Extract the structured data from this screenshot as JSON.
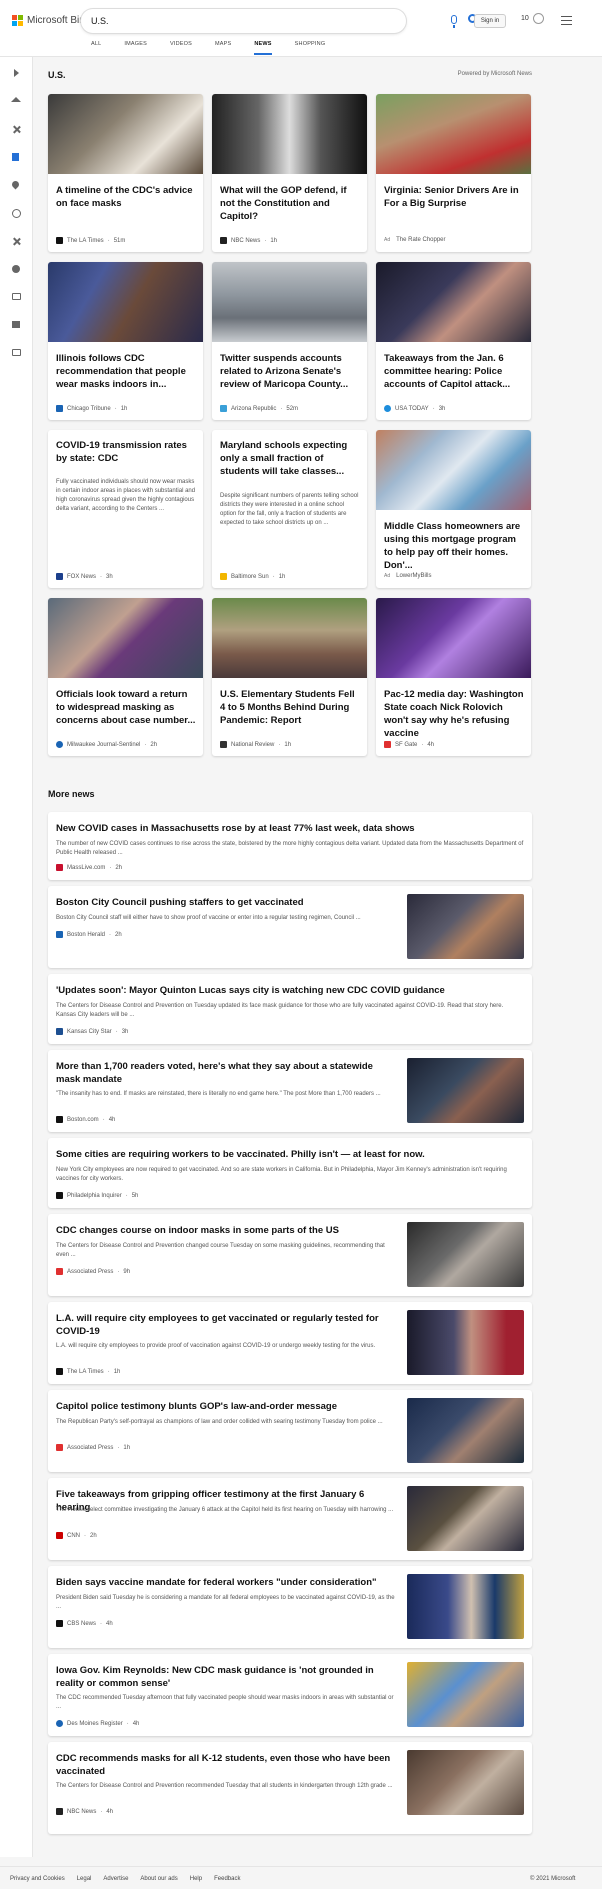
{
  "brand": {
    "name": "Microsoft Bing"
  },
  "search": {
    "query": "U.S."
  },
  "header": {
    "sign_in": "Sign in",
    "rewards_points": "10"
  },
  "tabs": [
    "ALL",
    "IMAGES",
    "VIDEOS",
    "MAPS",
    "NEWS",
    "SHOPPING"
  ],
  "section": {
    "title": "U.S.",
    "powered_by": "Powered by Microsoft News"
  },
  "cards": [
    {
      "title": "A timeline of the CDC's advice on face masks",
      "source": "The LA Times",
      "time": "51m",
      "ad": false,
      "fav": "#111"
    },
    {
      "title": "What will the GOP defend, if not the Constitution and Capitol?",
      "source": "NBC News",
      "time": "1h",
      "ad": false,
      "fav": "#222"
    },
    {
      "title": "Virginia: Senior Drivers Are in For a Big Surprise",
      "source": "The Rate Chopper",
      "time": "",
      "ad": true,
      "ad_label": "Ad",
      "fav": "#fff"
    },
    {
      "title": "Illinois follows CDC recommendation that people wear masks indoors in...",
      "source": "Chicago Tribune",
      "time": "1h",
      "ad": false,
      "fav": "#1a64b4"
    },
    {
      "title": "Twitter suspends accounts related to Arizona Senate's review of Maricopa County...",
      "source": "Arizona Republic",
      "time": "52m",
      "ad": false,
      "fav": "#3aa0d8"
    },
    {
      "title": "Takeaways from the Jan. 6 committee hearing: Police accounts of Capitol attack...",
      "source": "USA TODAY",
      "time": "3h",
      "ad": false,
      "fav": "#1d8ddc"
    },
    {
      "title": "COVID-19 transmission rates by state: CDC",
      "snippet": "Fully vaccinated individuals should now wear masks in certain indoor areas in places with substantial and high coronavirus spread given the highly contagious delta variant, according to the Centers ...",
      "source": "FOX News",
      "time": "3h",
      "ad": false,
      "fav": "#1c3f8c"
    },
    {
      "title": "Maryland schools expecting only a small fraction of students will take classes...",
      "snippet": "Despite significant numbers of parents telling school districts they were interested in a online school option for the fall, only a fraction of students are expected to take school districts up on ...",
      "source": "Baltimore Sun",
      "time": "1h",
      "ad": false,
      "fav": "#f2b600"
    },
    {
      "title": "Middle Class homeowners are using this mortgage program to help pay off their homes. Don'...",
      "source": "LowerMyBills",
      "time": "",
      "ad": true,
      "ad_label": "Ad",
      "fav": "#fff"
    },
    {
      "title": "Officials look toward a return to widespread masking as concerns about case number...",
      "source": "Milwaukee Journal-Sentinel",
      "time": "2h",
      "ad": false,
      "fav": "#1a64b4"
    },
    {
      "title": "U.S. Elementary Students Fell 4 to 5 Months Behind During Pandemic: Report",
      "source": "National Review",
      "time": "1h",
      "ad": false,
      "fav": "#333"
    },
    {
      "title": "Pac-12 media day: Washington State coach Nick Rolovich won't say why he's refusing vaccine",
      "source": "SF Gate",
      "time": "4h",
      "ad": false,
      "fav": "#e03030"
    }
  ],
  "more_news": {
    "title": "More news",
    "items": [
      {
        "title": "New COVID cases in Massachusetts rose by at least 77% last week, data shows",
        "snippet": "The number of new COVID cases continues to rise across the state, bolstered by the more highly contagious delta variant. Updated data from the Massachusetts Department of Public Health released ...",
        "source": "MassLive.com",
        "time": "2h",
        "fav": "#c8102e"
      },
      {
        "title": "Boston City Council pushing staffers to get vaccinated",
        "snippet": "Boston City Council staff will either have to show proof of vaccine or enter into a regular testing regimen, Council ...",
        "source": "Boston Herald",
        "time": "2h",
        "fav": "#1a64b4"
      },
      {
        "title": "'Updates soon': Mayor Quinton Lucas says city is watching new CDC COVID guidance",
        "snippet": "The Centers for Disease Control and Prevention on Tuesday updated its face mask guidance for those who are fully vaccinated against COVID-19. Read that story here. Kansas City leaders will be ...",
        "source": "Kansas City Star",
        "time": "3h",
        "fav": "#1d4f91"
      },
      {
        "title": "More than 1,700 readers voted, here's what they say about a statewide mask mandate",
        "snippet": "\"The insanity has to end. If masks are reinstated, there is literally no end game here.\" The post More than 1,700 readers ...",
        "source": "Boston.com",
        "time": "4h",
        "fav": "#111"
      },
      {
        "title": "Some cities are requiring workers to be vaccinated. Philly isn't — at least for now.",
        "snippet": "New York City employees are now required to get vaccinated. And so are state workers in California. But in Philadelphia, Mayor Jim Kenney's administration isn't requiring vaccines for city workers.",
        "source": "Philadelphia Inquirer",
        "time": "5h",
        "fav": "#111"
      },
      {
        "title": "CDC changes course on indoor masks in some parts of the US",
        "snippet": "The Centers for Disease Control and Prevention changed course Tuesday on some masking guidelines, recommending that even ...",
        "source": "Associated Press",
        "time": "9h",
        "fav": "#e03030"
      },
      {
        "title": "L.A. will require city employees to get vaccinated or regularly tested for COVID-19",
        "snippet": "L.A. will require city employees to provide proof of vaccination against COVID-19 or undergo weekly testing for the virus.",
        "source": "The LA Times",
        "time": "1h",
        "fav": "#111"
      },
      {
        "title": "Capitol police testimony blunts GOP's law-and-order message",
        "snippet": "The Republican Party's self-portrayal as champions of law and order collided with searing testimony Tuesday from police ...",
        "source": "Associated Press",
        "time": "1h",
        "fav": "#e03030"
      },
      {
        "title": "Five takeaways from gripping officer testimony at the first January 6 hearing",
        "snippet": "The House select committee investigating the January 6 attack at the Capitol held its first hearing on Tuesday with harrowing ...",
        "source": "CNN",
        "time": "2h",
        "fav": "#cc0000"
      },
      {
        "title": "Biden says vaccine mandate for federal workers \"under consideration\"",
        "snippet": "President Biden said Tuesday he is considering a mandate for all federal employees to be vaccinated against COVID-19, as the ...",
        "source": "CBS News",
        "time": "4h",
        "fav": "#111"
      },
      {
        "title": "Iowa Gov. Kim Reynolds: New CDC mask guidance is 'not grounded in reality or common sense'",
        "snippet": "The CDC recommended Tuesday afternoon that fully vaccinated people should wear masks indoors in areas with substantial or ...",
        "source": "Des Moines Register",
        "time": "4h",
        "fav": "#1a64b4"
      },
      {
        "title": "CDC recommends masks for all K-12 students, even those who have been vaccinated",
        "snippet": "The Centers for Disease Control and Prevention recommended Tuesday that all students in kindergarten through 12th grade ...",
        "source": "NBC News",
        "time": "4h",
        "fav": "#222"
      }
    ]
  },
  "footer": {
    "links": [
      "Privacy and Cookies",
      "Legal",
      "Advertise",
      "About our ads",
      "Help",
      "Feedback"
    ],
    "copyright": "© 2021 Microsoft"
  },
  "colors": {
    "accent": "#2470d6",
    "background": "#f5f5f5",
    "card": "#ffffff"
  }
}
